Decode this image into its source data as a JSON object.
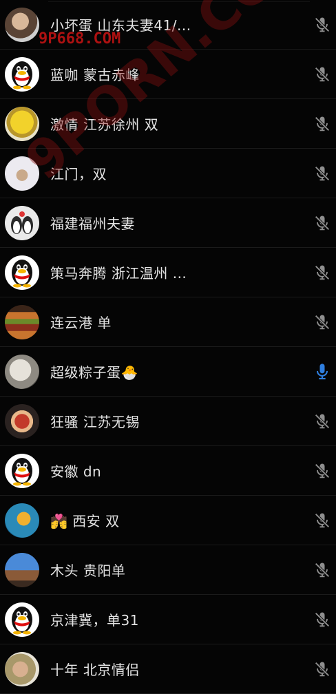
{
  "rows": [
    {
      "name": "小坏蛋 山东夫妻41/...",
      "avatar": "person-photo-avatar",
      "muted": true
    },
    {
      "name": "蓝咖 蒙古赤峰",
      "avatar": "qq-penguin-avatar",
      "muted": true
    },
    {
      "name": "激情 江苏徐州 双",
      "avatar": "yellow-mascot-avatar",
      "muted": true
    },
    {
      "name": "江门，双",
      "avatar": "white-hood-avatar",
      "muted": true
    },
    {
      "name": "福建福州夫妻",
      "avatar": "penguins-avatar",
      "muted": true
    },
    {
      "name": "策马奔腾 浙江温州 ...",
      "avatar": "qq-penguin-avatar",
      "muted": true
    },
    {
      "name": "连云港  单",
      "avatar": "burger-avatar",
      "muted": true
    },
    {
      "name": "超级粽子蛋🐣",
      "avatar": "cat-avatar",
      "muted": false
    },
    {
      "name": "狂骚 江苏无锡",
      "avatar": "cartoon-avatar",
      "muted": true
    },
    {
      "name": "安徽  dn",
      "avatar": "qq-penguin-avatar",
      "muted": true
    },
    {
      "name": "💏  西安 双",
      "avatar": "cartoon-swimmer-avatar",
      "muted": true
    },
    {
      "name": "木头  贵阳单",
      "avatar": "church-photo-avatar",
      "muted": true
    },
    {
      "name": "京津冀，单31",
      "avatar": "qq-penguin-avatar",
      "muted": true
    },
    {
      "name": "十年 北京情侣",
      "avatar": "couple-photo-avatar",
      "muted": true
    }
  ],
  "watermarks": {
    "top": "9P668.COM",
    "diagonal": "9PORN.COM"
  },
  "colors": {
    "background": "#050505",
    "text": "#e4e4e4",
    "mic_muted": "#8f8f8f",
    "mic_active": "#2f7fe0"
  }
}
